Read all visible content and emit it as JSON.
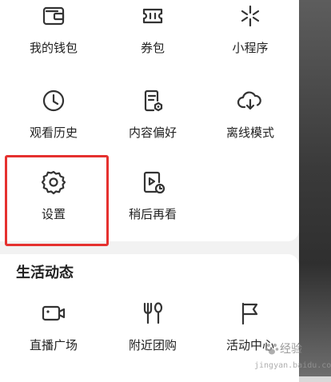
{
  "menu_top": {
    "items": [
      {
        "label": "我的钱包",
        "icon": "wallet-icon"
      },
      {
        "label": "券包",
        "icon": "ticket-icon"
      },
      {
        "label": "小程序",
        "icon": "mini-program-icon"
      },
      {
        "label": "观看历史",
        "icon": "clock-icon"
      },
      {
        "label": "内容偏好",
        "icon": "content-preference-icon"
      },
      {
        "label": "离线模式",
        "icon": "cloud-download-icon"
      },
      {
        "label": "设置",
        "icon": "gear-icon"
      },
      {
        "label": "稍后再看",
        "icon": "watch-later-icon"
      }
    ]
  },
  "life": {
    "title": "生活动态",
    "items": [
      {
        "label": "直播广场",
        "icon": "video-camera-icon"
      },
      {
        "label": "附近团购",
        "icon": "fork-spoon-icon"
      },
      {
        "label": "活动中心",
        "icon": "flag-icon"
      }
    ]
  },
  "highlight_color": "#e5312f",
  "watermark": {
    "main": "经验",
    "sub": "jingyan.baidu.com"
  }
}
